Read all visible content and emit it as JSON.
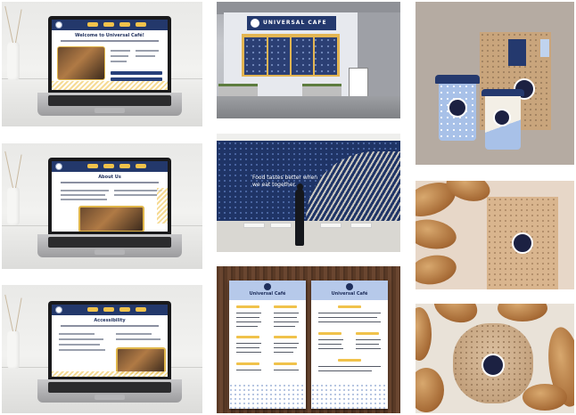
{
  "mockups": {
    "laptop_home": {
      "heading": "Welcome to Universal Café!"
    },
    "laptop_about": {
      "heading": "About Us"
    },
    "laptop_accessibility": {
      "heading": "Accessibility"
    },
    "storefront": {
      "sign_text": "UNIVERSAL CAFE"
    },
    "wall_mural": {
      "line1": "Food tastes better when",
      "line2": "we eat together."
    },
    "menus": {
      "left_title": "Universal Café",
      "right_title": "Universal Café"
    }
  },
  "colors": {
    "brand_navy": "#24396e",
    "brand_yellow": "#f0c24b",
    "brand_light_blue": "#b6c9ea"
  }
}
